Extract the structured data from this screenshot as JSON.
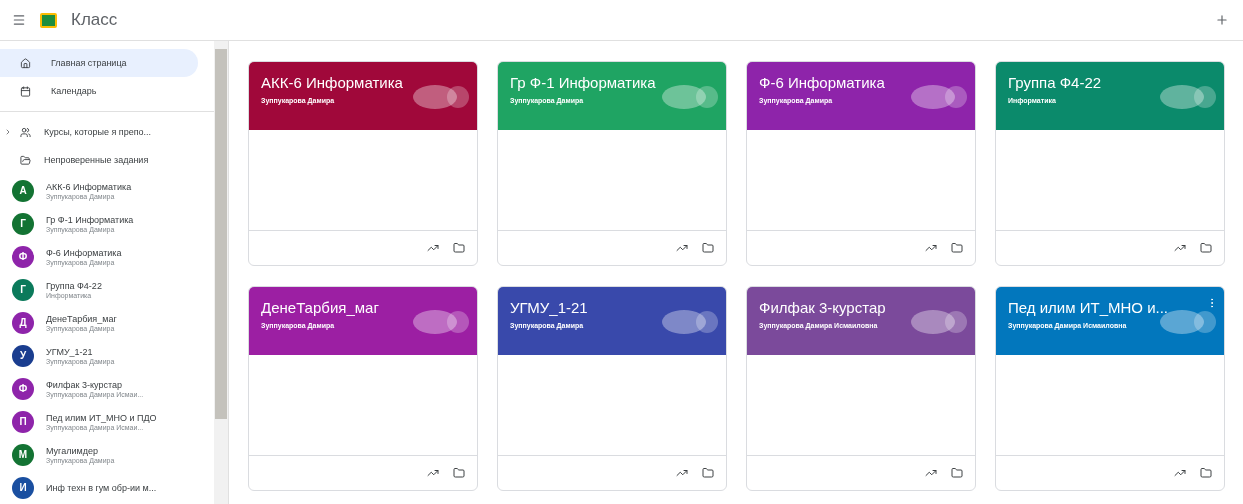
{
  "header": {
    "app_name": "Класс"
  },
  "sidebar": {
    "nav": [
      {
        "kind": "home",
        "label": "Главная страница",
        "selected": true
      },
      {
        "kind": "calendar",
        "label": "Календарь",
        "selected": false
      }
    ],
    "section": [
      {
        "kind": "teaching",
        "label": "Курсы, которые я препо...",
        "selected": false
      },
      {
        "kind": "tasks",
        "label": "Непроверенные задания",
        "selected": false
      }
    ],
    "courses": [
      {
        "letter": "А",
        "name": "АКК-6 Информатика",
        "subtitle": "Зуппукарова Дамира",
        "color": "#137333",
        "selected": false
      },
      {
        "letter": "Г",
        "name": "Гр Ф-1 Информатика",
        "subtitle": "Зуппукарова Дамира",
        "color": "#137333",
        "selected": false
      },
      {
        "letter": "Ф",
        "name": "Ф-6 Информатика",
        "subtitle": "Зуппукарова Дамира",
        "color": "#8e24aa",
        "selected": false
      },
      {
        "letter": "Г",
        "name": "Группа Ф4-22",
        "subtitle": "Информатика",
        "color": "#0b7a5b",
        "selected": false
      },
      {
        "letter": "Д",
        "name": "ДенеТарбия_маг",
        "subtitle": "Зуппукарова Дамира",
        "color": "#8e24aa",
        "selected": false
      },
      {
        "letter": "У",
        "name": "УГМУ_1-21",
        "subtitle": "Зуппукарова Дамира",
        "color": "#1a3d8f",
        "selected": false
      },
      {
        "letter": "Ф",
        "name": "Филфак 3-курстар",
        "subtitle": "Зуппукарова Дамира Исмаи...",
        "color": "#8e24aa",
        "selected": false
      },
      {
        "letter": "П",
        "name": "Пед илим ИТ_МНО и ПДО",
        "subtitle": "Зуппукарова Дамира Исмаи...",
        "color": "#8e24aa",
        "selected": false
      },
      {
        "letter": "М",
        "name": "Мугалимдер",
        "subtitle": "Зуппукарова Дамира",
        "color": "#137333",
        "selected": false
      },
      {
        "letter": "И",
        "name": "Инф техн в гум обр-ии м...",
        "color": "#1a4fa0",
        "selected": false
      }
    ]
  },
  "cards": [
    {
      "title": "АКК-6 Информатика",
      "subtitle": "Зуппукарова Дамира",
      "color": "#a0083a"
    },
    {
      "title": "Гр Ф-1 Информатика",
      "subtitle": "Зуппукарова Дамира",
      "color": "#1fa463"
    },
    {
      "title": "Ф-6 Информатика",
      "subtitle": "Зуппукарова Дамира",
      "color": "#8e24aa"
    },
    {
      "title": "Группа Ф4-22",
      "subtitle": "Информатика",
      "color": "#0b8a6b"
    },
    {
      "title": "ДенеТарбия_маг",
      "subtitle": "Зуппукарова Дамира",
      "color": "#9c1fa3"
    },
    {
      "title": "УГМУ_1-21",
      "subtitle": "Зуппукарова Дамира",
      "color": "#3949ab"
    },
    {
      "title": "Филфак 3-курстар",
      "subtitle": "Зуппукарова Дамира Исмаиловна",
      "color": "#7b4a9b"
    },
    {
      "title": "Пед илим ИТ_МНО и...",
      "subtitle": "Зуппукарова Дамира Исмаиловна",
      "color": "#0277bd",
      "menu": true
    }
  ]
}
